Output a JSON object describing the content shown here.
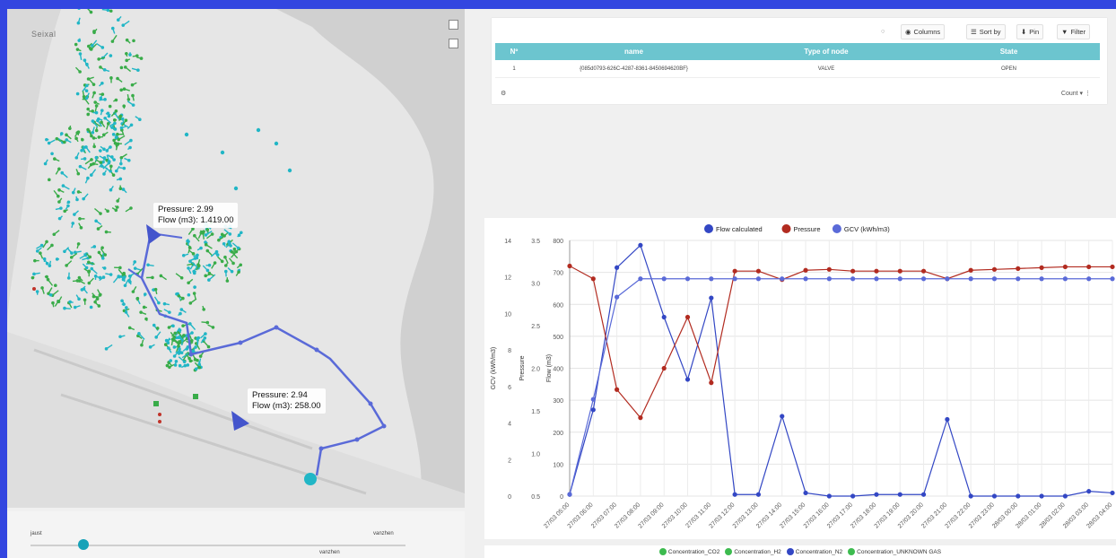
{
  "map": {
    "tooltip_a": {
      "pressure": "Pressure: 2.99",
      "flow": "Flow (m3): 1.419.00"
    },
    "tooltip_b": {
      "pressure": "Pressure: 2.94",
      "flow": "Flow (m3): 258.00"
    },
    "place_label": "Seixal"
  },
  "slider": {
    "label_left": "jaust",
    "label_right": "vanzhen",
    "label_knob_right": "vanzhen",
    "position": 0.14
  },
  "table": {
    "toolbar": {
      "columns": "Columns",
      "sort_by": "Sort by",
      "pin": "Pin",
      "filter": "Filter"
    },
    "columns": [
      "Nº",
      "name",
      "Type of node",
      "State"
    ],
    "rows": [
      [
        "1",
        "{085d0793-626C-4287-8361-8450694620BF}",
        "VALVE",
        "OPEN"
      ]
    ],
    "footer": {
      "count": "Count"
    }
  },
  "chart_data": {
    "type": "line",
    "legend": [
      "Flow calculated",
      "Pressure",
      "GCV (kWh/m3)"
    ],
    "legend_colors": [
      "#3347c4",
      "#b22b20",
      "#5a6ad8"
    ],
    "categories": [
      "27/03 05:00",
      "27/03 06:00",
      "27/03 07:00",
      "27/03 08:00",
      "27/03 09:00",
      "27/03 10:00",
      "27/03 11:00",
      "27/03 12:00",
      "27/03 13:00",
      "27/03 14:00",
      "27/03 15:00",
      "27/03 16:00",
      "27/03 17:00",
      "27/03 18:00",
      "27/03 19:00",
      "27/03 20:00",
      "27/03 21:00",
      "27/03 22:00",
      "27/03 23:00",
      "28/03 00:00",
      "28/03 01:00",
      "28/03 02:00",
      "28/03 03:00",
      "28/03 04:00"
    ],
    "axes": {
      "gcv": {
        "label": "GCV (kWh/m3)",
        "ticks": [
          0,
          2,
          4,
          6,
          8,
          10,
          12,
          14
        ]
      },
      "pressure": {
        "label": "Pressure",
        "ticks": [
          0.5,
          1.0,
          1.5,
          2.0,
          2.5,
          3.0,
          3.5
        ]
      },
      "flow": {
        "label": "Flow (m3)",
        "ticks": [
          0,
          100,
          200,
          300,
          400,
          500,
          600,
          700,
          800
        ]
      }
    },
    "series": [
      {
        "name": "Flow calculated",
        "axis": "flow",
        "values": [
          5,
          270,
          715,
          785,
          560,
          365,
          620,
          5,
          5,
          250,
          10,
          0,
          0,
          5,
          5,
          5,
          240,
          0,
          0,
          0,
          0,
          0,
          15,
          10
        ]
      },
      {
        "name": "Pressure",
        "axis": "pressure",
        "values": [
          3.2,
          3.05,
          1.75,
          1.42,
          2.0,
          2.6,
          1.83,
          3.14,
          3.14,
          3.04,
          3.15,
          3.16,
          3.14,
          3.14,
          3.14,
          3.14,
          3.05,
          3.15,
          3.16,
          3.17,
          3.18,
          3.19,
          3.19,
          3.19
        ]
      },
      {
        "name": "GCV (kWh/m3)",
        "axis": "gcv",
        "values": [
          0.1,
          5.3,
          10.9,
          11.9,
          11.9,
          11.9,
          11.9,
          11.9,
          11.9,
          11.9,
          11.9,
          11.9,
          11.9,
          11.9,
          11.9,
          11.9,
          11.9,
          11.9,
          11.9,
          11.9,
          11.9,
          11.9,
          11.9,
          11.9
        ]
      }
    ],
    "grid": true,
    "legend_position": "top-center"
  },
  "bottom_legend": [
    {
      "label": "Concentration_CO2",
      "color": "#3dbb4f"
    },
    {
      "label": "Concentration_H2",
      "color": "#3dbb4f"
    },
    {
      "label": "Concentration_N2",
      "color": "#3347c4"
    },
    {
      "label": "Concentration_UNKNOWN GAS",
      "color": "#3dbb4f"
    }
  ]
}
